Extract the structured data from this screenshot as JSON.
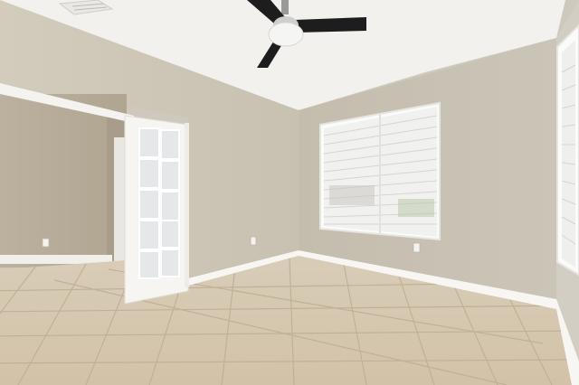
{
  "scene": {
    "description_free": true,
    "colors": {
      "ceiling": "#f3f2ee",
      "left_wall": "#cfc8b9",
      "back_wall": "#c6c0b2",
      "right_wall": "#d4cfc4",
      "closet_wall": "#b9ae9d",
      "floor_tile": "#d6c7b0",
      "grout": "#c2b39b",
      "trim": "#f6f5f1",
      "door_glass": "#e8eaeb",
      "blinds": "#f2f2f0",
      "fan_blade": "#1c1c1c"
    },
    "icons": [
      "ceiling-fan-icon",
      "air-vent-icon",
      "outlet-icon"
    ]
  }
}
